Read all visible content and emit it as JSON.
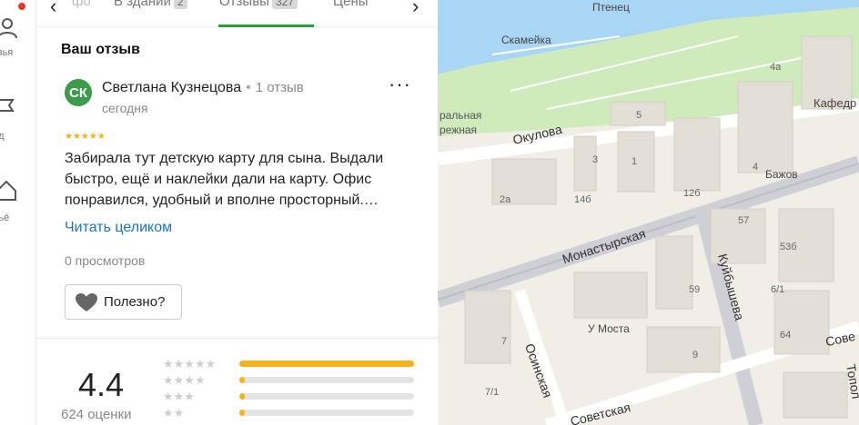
{
  "rail": {
    "items": [
      {
        "label": "узья",
        "icon": "friends-icon"
      },
      {
        "label": "ид",
        "icon": "guide-icon"
      },
      {
        "label": "льё",
        "icon": "housing-icon"
      }
    ]
  },
  "tabs": {
    "items": [
      {
        "label": "фо",
        "badge": ""
      },
      {
        "label": "В здании",
        "badge": "2"
      },
      {
        "label": "Отзывы",
        "badge": "327"
      },
      {
        "label": "Цены",
        "badge": ""
      }
    ],
    "active": "Отзывы"
  },
  "review": {
    "section_title": "Ваш отзыв",
    "avatar_initials": "СК",
    "author": "Светлана Кузнецова",
    "author_reviews": "1 отзыв",
    "date": "сегодня",
    "stars": "★★★★★",
    "text": "Забирала тут детскую карту для сына. Выдали быстро, ещё и наклейки дали на карту. Офис понравился, удобный и вполне просторный.…",
    "read_more": "Читать целиком",
    "views": "0 просмотров",
    "useful_label": "Полезно?"
  },
  "rating": {
    "value": "4.4",
    "count": "624 оценки",
    "distribution": [
      {
        "stars": "★★★★★",
        "fraction": 1.0
      },
      {
        "stars": "★★★★",
        "fraction": 0.02
      },
      {
        "stars": "★★★",
        "fraction": 0.03
      },
      {
        "stars": "★★",
        "fraction": 0.03
      }
    ]
  },
  "map": {
    "places": [
      "Птенец",
      "Скамейка",
      "Бажов",
      "Кафедр",
      "У Моста",
      "ральная",
      "режная"
    ],
    "streets": [
      "Окулова",
      "Монастырская",
      "Куйбышева",
      "Осинская",
      "Советская",
      "Сове",
      "Топол"
    ],
    "house_numbers": [
      "4а",
      "5",
      "3",
      "1",
      "2а",
      "14б",
      "12б",
      "4",
      "57",
      "53б",
      "59",
      "6/1",
      "64",
      "7",
      "9",
      "7/1"
    ],
    "colors": {
      "river": "#a9d6f5",
      "park": "#c9e8b5",
      "road": "#ffffff",
      "major_road": "#cfcfd6",
      "building": "#e6e2da"
    }
  },
  "colors": {
    "accent_green": "#279c3f",
    "star": "#f6b21b",
    "link": "#1a73c8"
  }
}
